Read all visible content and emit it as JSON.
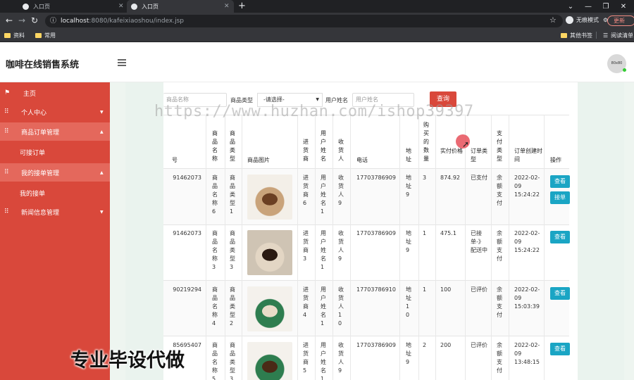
{
  "browser": {
    "tabs": [
      {
        "title": "入口页",
        "active": false
      },
      {
        "title": "入口页",
        "active": false
      },
      {
        "title": "入口页",
        "active": true
      }
    ],
    "url_host": "localhost",
    "url_rest": ":8080/kafeixiaoshou/index.jsp",
    "incognito_label": "无痕模式",
    "update_label": "更新",
    "bookmarks": [
      "资料",
      "常用"
    ],
    "bookmarks_right": [
      "其他书签",
      "阅读清单"
    ]
  },
  "header": {
    "title": "咖啡在线销售系统",
    "avatar_text": "80x80"
  },
  "sidebar": {
    "items": [
      {
        "label": "主页",
        "icon": "flag-icon"
      },
      {
        "label": "个人中心",
        "icon": "grid-icon"
      },
      {
        "label": "商品订单管理",
        "icon": "grid-icon"
      },
      {
        "label": "可接订单",
        "sub": true
      },
      {
        "label": "我的接单管理",
        "icon": "grid-icon"
      },
      {
        "label": "我的接单",
        "sub": true
      },
      {
        "label": "新闻信息管理",
        "icon": "grid-icon"
      }
    ]
  },
  "search": {
    "name_placeholder": "商品名称",
    "type_label": "商品类型",
    "type_value": "-请选择-",
    "user_label": "用户姓名",
    "user_placeholder": "用户姓名",
    "query_button": "查询"
  },
  "table": {
    "headers": [
      "号",
      "商品名称",
      "商品类型",
      "商品图片",
      "进货商",
      "用户姓名",
      "收货人",
      "电话",
      "地址",
      "购买的数量",
      "实付价格",
      "订单类型",
      "支付类型",
      "订单创建时间",
      "操作"
    ],
    "rows": [
      {
        "no": "91462073",
        "name": "商品名称6",
        "type": "商品类型1",
        "supplier": "进货商6",
        "user": "用户姓名1",
        "receiver": "收货人9",
        "phone": "17703786909",
        "addr": "地址9",
        "qty": "3",
        "price": "874.92",
        "order_type": "已支付",
        "pay_type": "余额支付",
        "time": "2022-02-09 15:24:22",
        "actions": [
          "查看",
          "接单"
        ]
      },
      {
        "no": "91462073",
        "name": "商品名称3",
        "type": "商品类型3",
        "supplier": "进货商3",
        "user": "用户姓名1",
        "receiver": "收货人9",
        "phone": "17703786909",
        "addr": "地址9",
        "qty": "1",
        "price": "475.1",
        "order_type": "已接单-》配送中",
        "pay_type": "余额支付",
        "time": "2022-02-09 15:24:22",
        "actions": [
          "查看"
        ]
      },
      {
        "no": "90219294",
        "name": "商品名称4",
        "type": "商品类型2",
        "supplier": "进货商4",
        "user": "用户姓名1",
        "receiver": "收货人10",
        "phone": "17703786910",
        "addr": "地址10",
        "qty": "1",
        "price": "100",
        "order_type": "已评价",
        "pay_type": "余额支付",
        "time": "2022-02-09 15:03:39",
        "actions": [
          "查看"
        ]
      },
      {
        "no": "85695407",
        "name": "商品名称5",
        "type": "商品类型3",
        "supplier": "进货商5",
        "user": "用户姓名1",
        "receiver": "收货人9",
        "phone": "17703786909",
        "addr": "地址9",
        "qty": "2",
        "price": "200",
        "order_type": "已评价",
        "pay_type": "余额支付",
        "time": "2022-02-09 13:48:15",
        "actions": [
          "查看"
        ]
      }
    ]
  },
  "watermark": "https://www.huzhan.com/ishop39397",
  "overlay_text": "专业毕设代做",
  "colors": {
    "sidebar": "#d9483b",
    "button": "#1aa5c4",
    "query": "#d9483b"
  }
}
